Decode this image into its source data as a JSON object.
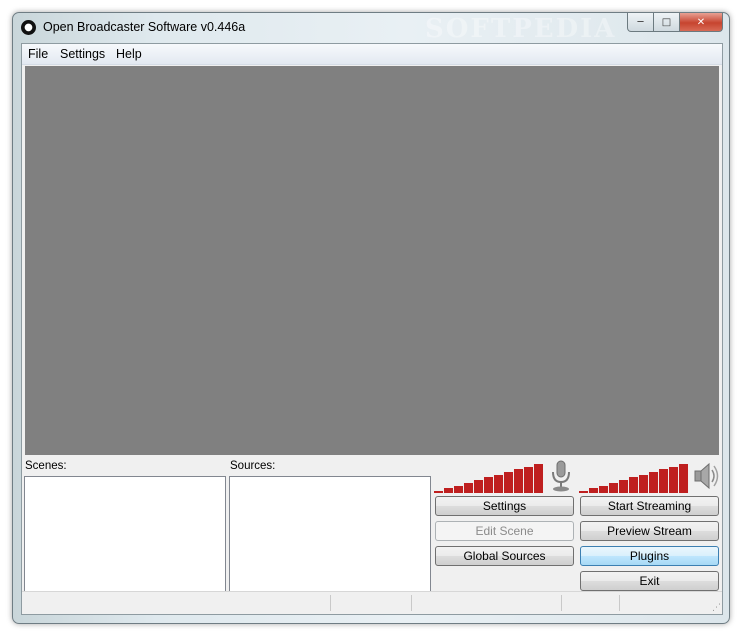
{
  "window": {
    "title": "Open Broadcaster Software v0.446a",
    "watermark": "SOFTPEDIA"
  },
  "menu": [
    "File",
    "Settings",
    "Help"
  ],
  "panels": {
    "scenes_label": "Scenes:",
    "sources_label": "Sources:"
  },
  "meters": {
    "mic_level": 1.0,
    "desktop_level": 1.0
  },
  "buttons": {
    "settings": "Settings",
    "start_streaming": "Start Streaming",
    "edit_scene": "Edit Scene",
    "preview_stream": "Preview Stream",
    "global_sources": "Global Sources",
    "plugins": "Plugins",
    "exit": "Exit"
  },
  "colors": {
    "preview_bg": "#808080",
    "meter_red": "#bf1f1f"
  },
  "icons": {
    "app": "obs-logo-icon",
    "mic": "microphone-icon",
    "speaker": "speaker-icon"
  }
}
